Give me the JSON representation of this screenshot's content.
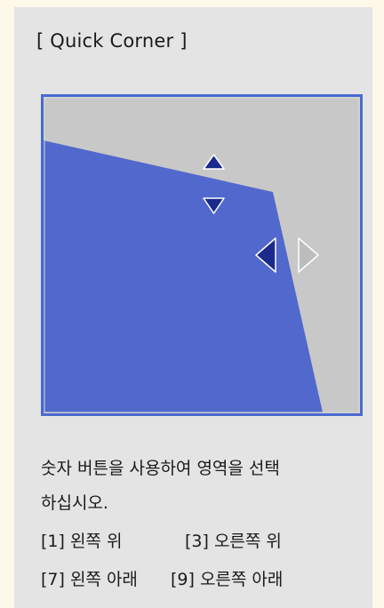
{
  "dialog": {
    "title": "[ Quick Corner ]"
  },
  "instructions": {
    "line1": "숫자 버튼을 사용하여 영역을 선택",
    "line2": "하십시오.",
    "keys": [
      {
        "label": "[1] 왼쪽 위"
      },
      {
        "label": "[3] 오른쪽 위"
      },
      {
        "label": "[7] 왼쪽 아래"
      },
      {
        "label": "[9] 오른쪽 아래"
      }
    ]
  },
  "preview": {
    "selected_corner": "top-right",
    "arrows": [
      {
        "direction": "up",
        "state": "active",
        "icon": "arrow-up-icon"
      },
      {
        "direction": "down",
        "state": "active",
        "icon": "arrow-down-icon"
      },
      {
        "direction": "left",
        "state": "active",
        "icon": "arrow-left-icon"
      },
      {
        "direction": "right",
        "state": "inactive",
        "icon": "arrow-right-icon"
      }
    ]
  },
  "colors": {
    "panel_background": "#e4e4e4",
    "page_background": "#fdf8e8",
    "screen_border": "#4a6ad0",
    "projection_area": "#5169cc",
    "unused_area": "#c8c8c8",
    "active_arrow": "#1b2a8c",
    "inactive_arrow": "#bdbdbd"
  }
}
